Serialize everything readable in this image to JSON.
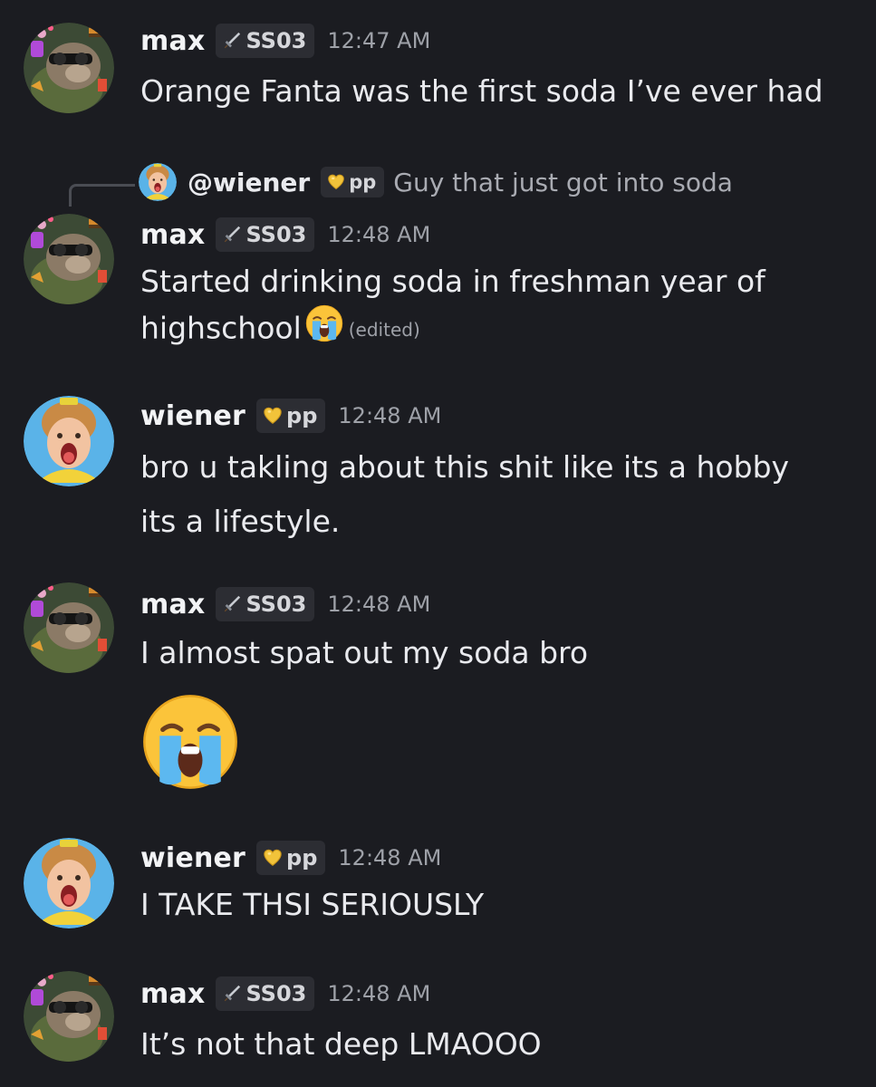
{
  "users": {
    "max": {
      "name": "max",
      "tag": "SS03",
      "tag_icon": "sword-icon"
    },
    "wiener": {
      "name": "wiener",
      "tag": "pp",
      "tag_icon": "gold-heart-icon"
    }
  },
  "colors": {
    "background": "#1b1c21",
    "tag_background": "#2c2d33",
    "timestamp": "#9ea1a8",
    "text": "#e9eaee"
  },
  "messages": [
    {
      "author": "max",
      "time": "12:47 AM",
      "text": "Orange Fanta was the first soda I’ve ever had"
    },
    {
      "author": "max",
      "time": "12:48 AM",
      "reply": {
        "mention": "@wiener",
        "tag": "pp",
        "text": "Guy that just got into soda"
      },
      "text": "Started drinking soda in freshman year of highschool",
      "inline_emoji": "loudly-crying-face",
      "edited": "(edited)"
    },
    {
      "author": "wiener",
      "time": "12:48 AM",
      "text": "bro u takling about this shit like its a hobby its a lifestyle."
    },
    {
      "author": "max",
      "time": "12:48 AM",
      "text": "I almost spat out my soda bro",
      "jumbo_emoji": "loudly-crying-face"
    },
    {
      "author": "wiener",
      "time": "12:48 AM",
      "text": "I TAKE THSI SERIOUSLY"
    },
    {
      "author": "max",
      "time": "12:48 AM",
      "text": "It’s not that deep LMAOOO"
    }
  ]
}
